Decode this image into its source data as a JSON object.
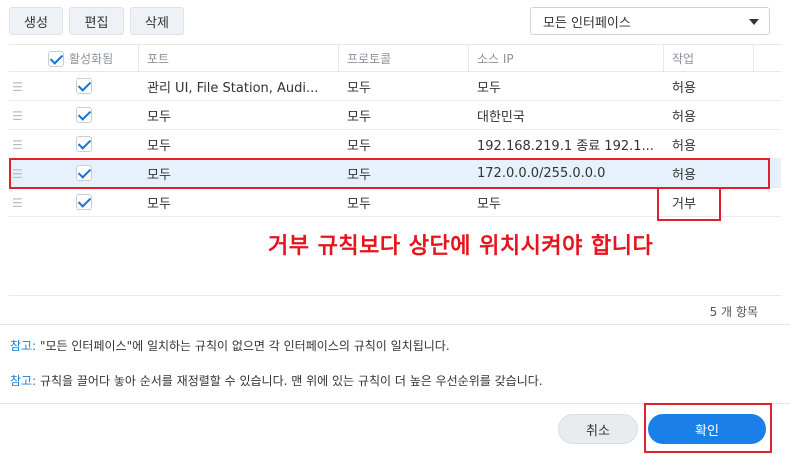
{
  "toolbar": {
    "create_label": "생성",
    "edit_label": "편집",
    "delete_label": "삭제",
    "interface_select": "모든 인터페이스"
  },
  "grid": {
    "columns": {
      "enabled": "활성화됨",
      "port": "포트",
      "protocol": "프로토콜",
      "source_ip": "소스 IP",
      "action": "작업"
    },
    "rows": [
      {
        "enabled": true,
        "port": "관리 UI, File Station, Audi...",
        "protocol": "모두",
        "source_ip": "모두",
        "action": "허용"
      },
      {
        "enabled": true,
        "port": "모두",
        "protocol": "모두",
        "source_ip": "대한민국",
        "action": "허용"
      },
      {
        "enabled": true,
        "port": "모두",
        "protocol": "모두",
        "source_ip": "192.168.219.1 종료 192.1...",
        "action": "허용"
      },
      {
        "enabled": true,
        "port": "모두",
        "protocol": "모두",
        "source_ip": "172.0.0.0/255.0.0.0",
        "action": "허용"
      },
      {
        "enabled": true,
        "port": "모두",
        "protocol": "모두",
        "source_ip": "모두",
        "action": "거부"
      }
    ],
    "count_label": "5 개 항목"
  },
  "annotation": "거부 규칙보다 상단에 위치시켜야 합니다",
  "notes": {
    "note_label": "참고:",
    "note1": "\"모든 인터페이스\"에 일치하는 규칙이 없으면 각 인터페이스의 규칙이 일치됩니다.",
    "note2": "규칙을 끌어다 놓아 순서를 재정렬할 수 있습니다. 맨 위에 있는 규칙이 더 높은 우선순위를 갖습니다."
  },
  "footer": {
    "cancel_label": "취소",
    "confirm_label": "확인"
  },
  "colors": {
    "accent": "#1a7fe8",
    "annotation_red": "#e8141c",
    "selected_row": "#e7f1fb"
  }
}
